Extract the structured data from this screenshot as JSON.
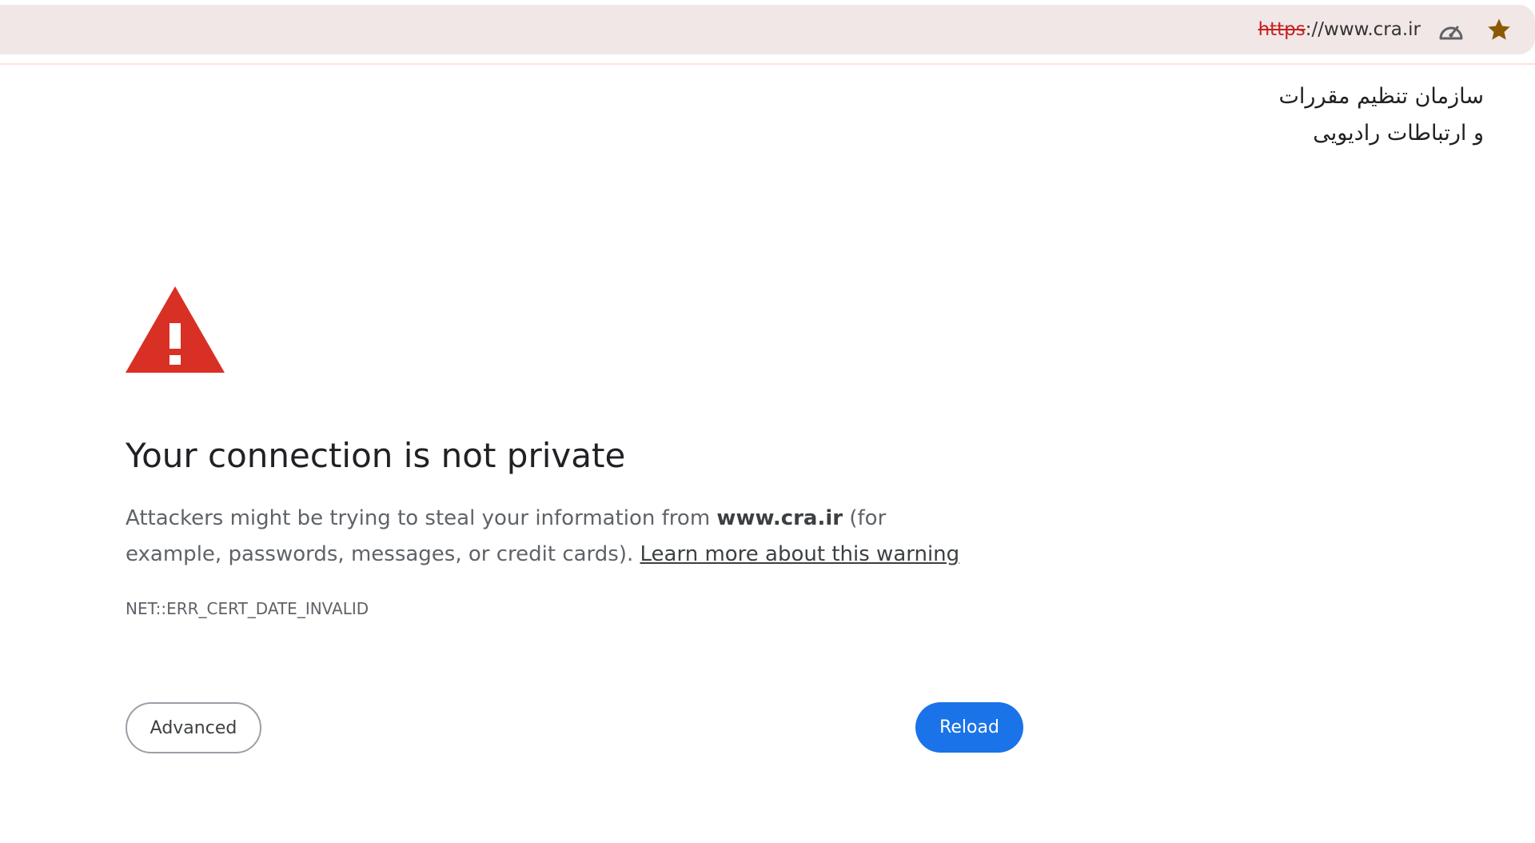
{
  "address_bar": {
    "scheme": "https",
    "rest": "://www.cra.ir",
    "performance_icon": "speedometer-icon",
    "bookmark_icon": "star-icon",
    "bookmark_color": "#8a5a00"
  },
  "site_label": {
    "line1": "سازمان تنظیم مقررات",
    "line2": "و ارتباطات رادیویی"
  },
  "interstitial": {
    "icon": "warning-triangle-icon",
    "icon_color": "#d93025",
    "title": "Your connection is not private",
    "desc_before": "Attackers might be trying to steal your information from ",
    "desc_host": "www.cra.ir",
    "desc_after": " (for example, passwords, messages, or credit cards). ",
    "learn_more": "Learn more about this warning",
    "error_code": "NET::ERR_CERT_DATE_INVALID",
    "advanced_label": "Advanced",
    "reload_label": "Reload",
    "accent_color": "#1a73e8"
  }
}
